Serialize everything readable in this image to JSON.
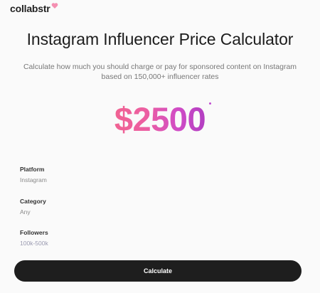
{
  "brand": {
    "logo_text": "collabstr"
  },
  "page": {
    "title": "Instagram Influencer Price Calculator",
    "subtitle": "Calculate how much you should charge or pay for sponsored content on Instagram based on 150,000+ influencer rates"
  },
  "result": {
    "price": "$2500"
  },
  "fields": {
    "platform": {
      "label": "Platform",
      "value": "Instagram"
    },
    "category": {
      "label": "Category",
      "value": "Any"
    },
    "followers": {
      "label": "Followers",
      "value": "100k-500k"
    }
  },
  "actions": {
    "calculate_label": "Calculate"
  },
  "colors": {
    "gradient_start": "#f06292",
    "gradient_end": "#b23ec2",
    "button_bg": "#1e1e1e"
  }
}
